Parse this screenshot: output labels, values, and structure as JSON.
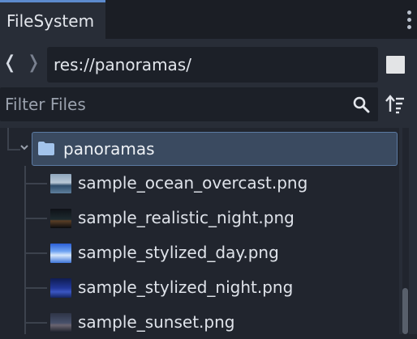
{
  "tab": {
    "title": "FileSystem"
  },
  "path": {
    "value": "res://panoramas/"
  },
  "filter": {
    "placeholder": "Filter Files"
  },
  "tree": {
    "folder": {
      "label": "panoramas",
      "expanded": true
    },
    "files": [
      {
        "name": "sample_ocean_overcast.png",
        "thumb": "ocean-overcast"
      },
      {
        "name": "sample_realistic_night.png",
        "thumb": "realistic-night"
      },
      {
        "name": "sample_stylized_day.png",
        "thumb": "stylized-day"
      },
      {
        "name": "sample_stylized_night.png",
        "thumb": "stylized-night"
      },
      {
        "name": "sample_sunset.png",
        "thumb": "sunset"
      }
    ]
  },
  "icons": {
    "back": "chevron-left-icon",
    "forward": "chevron-right-icon",
    "search": "search-icon",
    "sort": "sort-icon",
    "menu": "kebab-menu-icon",
    "folder": "folder-icon"
  },
  "colors": {
    "accent": "#5c8acd",
    "selection": "#3a4a60",
    "folder_icon": "#a3c4ec",
    "panel": "#282d37",
    "tree_bg": "#21252e"
  }
}
